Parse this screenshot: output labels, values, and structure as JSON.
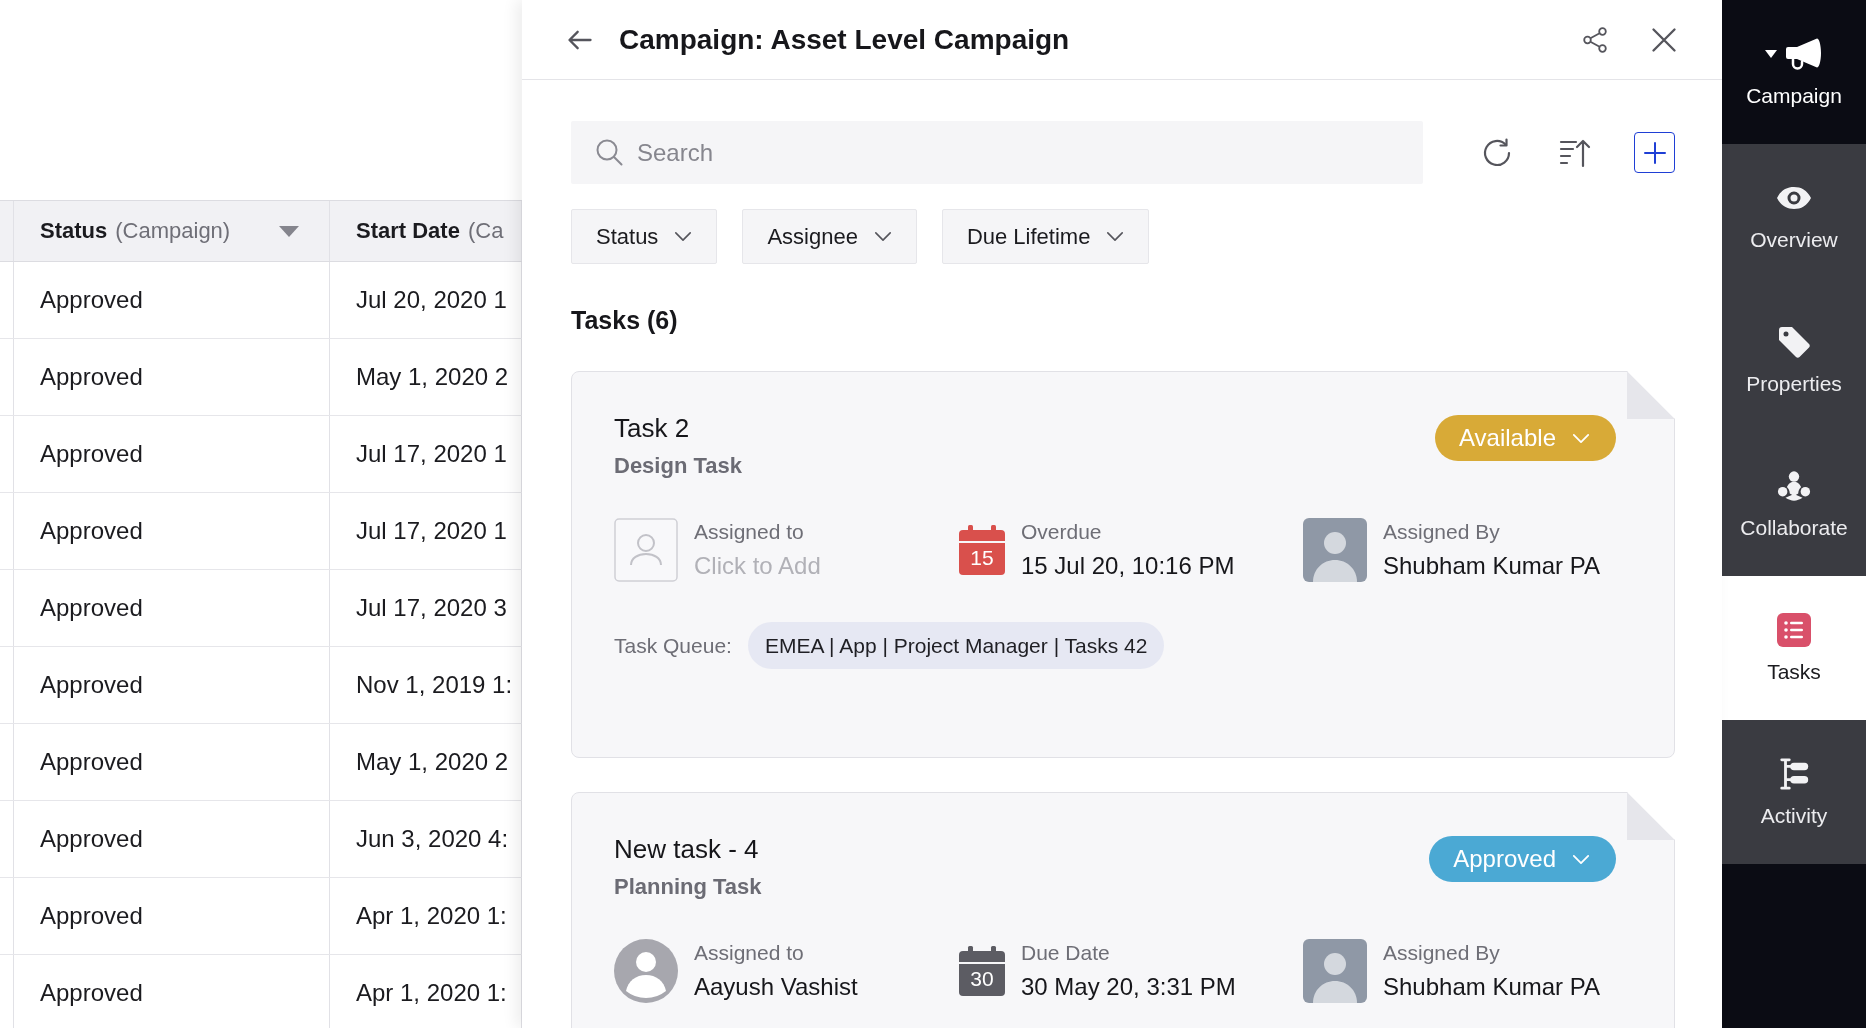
{
  "table": {
    "columns": [
      {
        "label": "Status",
        "qualifier": "(Campaign)",
        "sortable": true
      },
      {
        "label": "Start Date",
        "qualifier": "(Ca"
      }
    ],
    "rows": [
      {
        "status": "Approved",
        "start_date": "Jul 20, 2020 1"
      },
      {
        "status": "Approved",
        "start_date": "May 1, 2020 2"
      },
      {
        "status": "Approved",
        "start_date": "Jul 17, 2020 1"
      },
      {
        "status": "Approved",
        "start_date": "Jul 17, 2020 1"
      },
      {
        "status": "Approved",
        "start_date": "Jul 17, 2020 3"
      },
      {
        "status": "Approved",
        "start_date": "Nov 1, 2019 1:"
      },
      {
        "status": "Approved",
        "start_date": "May 1, 2020 2"
      },
      {
        "status": "Approved",
        "start_date": "Jun 3, 2020 4:"
      },
      {
        "status": "Approved",
        "start_date": "Apr 1, 2020 1:"
      },
      {
        "status": "Approved",
        "start_date": "Apr 1, 2020 1:"
      }
    ]
  },
  "panel": {
    "title": "Campaign: Asset Level Campaign",
    "search": {
      "placeholder": "Search"
    },
    "filters": [
      {
        "label": "Status"
      },
      {
        "label": "Assignee"
      },
      {
        "label": "Due Lifetime"
      }
    ],
    "tasks_heading": "Tasks (6)",
    "tasks": [
      {
        "title": "Task 2",
        "type": "Design Task",
        "status": {
          "label": "Available",
          "color": "#d8aa37"
        },
        "assignee": {
          "label": "Assigned to",
          "value": "Click to Add",
          "kind": "empty"
        },
        "due": {
          "label": "Overdue",
          "day": "15",
          "value": "15 Jul 20, 10:16 PM",
          "overdue": true
        },
        "assigned_by": {
          "label": "Assigned By",
          "value": "Shubham Kumar PA"
        },
        "queue": {
          "label": "Task Queue:",
          "value": "EMEA | App | Project Manager | Tasks 42"
        }
      },
      {
        "title": "New task - 4",
        "type": "Planning Task",
        "status": {
          "label": "Approved",
          "color": "#4ba9d4"
        },
        "assignee": {
          "label": "Assigned to",
          "value": "Aayush Vashist",
          "kind": "user"
        },
        "due": {
          "label": "Due Date",
          "day": "30",
          "value": "30 May 20, 3:31 PM",
          "overdue": false
        },
        "assigned_by": {
          "label": "Assigned By",
          "value": "Shubham Kumar PA"
        }
      }
    ]
  },
  "sidebar": {
    "items": [
      {
        "label": "Campaign",
        "kind": "context",
        "selected": false
      },
      {
        "label": "Overview",
        "kind": "tab",
        "selected": false
      },
      {
        "label": "Properties",
        "kind": "tab",
        "selected": false
      },
      {
        "label": "Collaborate",
        "kind": "tab",
        "selected": false
      },
      {
        "label": "Tasks",
        "kind": "tab",
        "selected": true
      },
      {
        "label": "Activity",
        "kind": "tab",
        "selected": false
      }
    ]
  }
}
